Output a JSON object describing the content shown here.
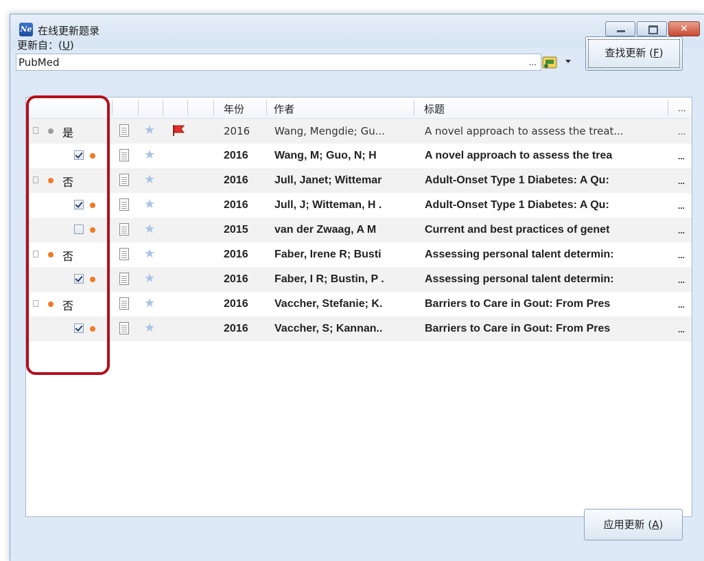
{
  "window": {
    "app_icon_text": "Ne",
    "title": "在线更新题录"
  },
  "source": {
    "label": "更新自：(",
    "label_key": "U",
    "label_end": ")",
    "value": "PubMed",
    "ellipsis": "..."
  },
  "buttons": {
    "find_label": "查找更新 (",
    "find_key": "F",
    "find_end": ")",
    "apply_label": "应用更新 (",
    "apply_key": "A",
    "apply_end": ")"
  },
  "columns": {
    "year": "年份",
    "author": "作者",
    "title": "标题",
    "more": "..."
  },
  "rows": [
    {
      "kind": "group",
      "verdict": "是",
      "dot": "grey",
      "flag": true,
      "bold": false,
      "year": "2016",
      "author": "Wang, Mengdie; Gu...",
      "title": "A novel approach to assess the treat...",
      "more": "..."
    },
    {
      "kind": "child",
      "checked": true,
      "dot": "orange",
      "bold": true,
      "year": "2016",
      "author": "Wang, M; Guo, N; H",
      "title": "A novel approach to assess the trea",
      "more": "..."
    },
    {
      "kind": "group",
      "verdict": "否",
      "dot": "orange",
      "flag": false,
      "bold": true,
      "year": "2016",
      "author": "Jull, Janet; Wittemar",
      "title": "Adult-Onset Type 1 Diabetes: A Qu:",
      "more": "..."
    },
    {
      "kind": "child",
      "checked": true,
      "dot": "orange",
      "bold": true,
      "year": "2016",
      "author": "Jull, J; Witteman, H .",
      "title": "Adult-Onset Type 1 Diabetes: A Qu:",
      "more": "..."
    },
    {
      "kind": "child",
      "checked": false,
      "dot": "orange",
      "bold": true,
      "year": "2015",
      "author": "van der Zwaag, A M",
      "title": "Current and best practices of genet",
      "more": "..."
    },
    {
      "kind": "group",
      "verdict": "否",
      "dot": "orange",
      "flag": false,
      "bold": true,
      "year": "2016",
      "author": "Faber, Irene R; Busti",
      "title": "Assessing personal talent determin:",
      "more": "..."
    },
    {
      "kind": "child",
      "checked": true,
      "dot": "orange",
      "bold": true,
      "year": "2016",
      "author": "Faber, I R; Bustin, P .",
      "title": "Assessing personal talent determin:",
      "more": "..."
    },
    {
      "kind": "group",
      "verdict": "否",
      "dot": "orange",
      "flag": false,
      "bold": true,
      "year": "2016",
      "author": "Vaccher, Stefanie; K.",
      "title": "Barriers to Care in Gout: From Pres",
      "more": "..."
    },
    {
      "kind": "child",
      "checked": true,
      "dot": "orange",
      "bold": true,
      "year": "2016",
      "author": "Vaccher, S; Kannan..",
      "title": "Barriers to Care in Gout: From Pres",
      "more": "..."
    }
  ],
  "colors": {
    "annotation": "#b30f1b",
    "dot_orange": "#f07a25",
    "dot_grey": "#9c9c9c",
    "flag_red": "#e0302b"
  }
}
